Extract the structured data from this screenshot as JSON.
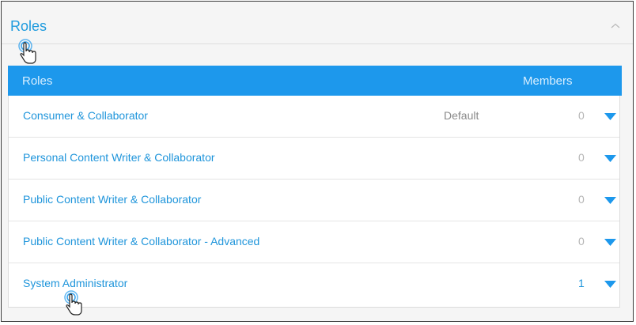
{
  "panel": {
    "title": "Roles"
  },
  "table": {
    "headers": {
      "roles": "Roles",
      "members": "Members"
    },
    "rows": [
      {
        "name": "Consumer & Collaborator",
        "badge": "Default",
        "members": "0"
      },
      {
        "name": "Personal Content Writer & Collaborator",
        "badge": "",
        "members": "0"
      },
      {
        "name": "Public Content Writer & Collaborator",
        "badge": "",
        "members": "0"
      },
      {
        "name": "Public Content Writer & Collaborator - Advanced",
        "badge": "",
        "members": "0"
      },
      {
        "name": "System Administrator",
        "badge": "",
        "members": "1"
      }
    ]
  },
  "colors": {
    "accent": "#1d98ec",
    "link": "#1f95db",
    "muted": "#b5b5b5"
  },
  "icons": {
    "collapse": "chevron-up-icon",
    "expand": "caret-down-icon",
    "cursor": "hand-pointer-icon"
  }
}
